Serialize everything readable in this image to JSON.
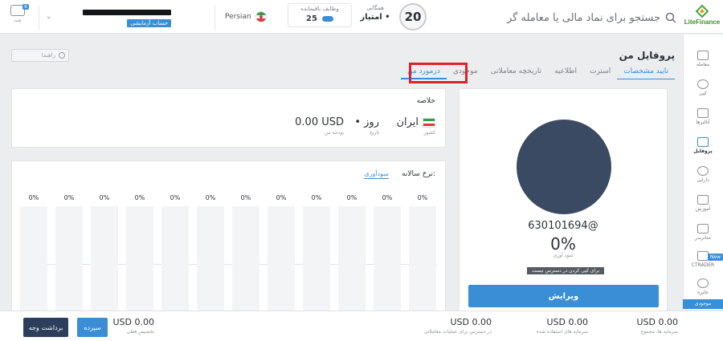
{
  "header": {
    "logo_text": "LiteFinance",
    "search_placeholder": "جستجو برای نماد مالی یا معامله گر",
    "level": "20",
    "rank_label": "همگانی",
    "rank_value": "• امتیاز",
    "tasks_label": "وظایف باقیمانده",
    "tasks_count": "25",
    "language": "Persian",
    "account_badge": "حساب آزمایشی",
    "chat_count": "6",
    "chat_label": "چت"
  },
  "sidebar": {
    "items": [
      {
        "label": "معامله",
        "icon": "chart-icon"
      },
      {
        "label": "کپی",
        "icon": "copy-icon"
      },
      {
        "label": "آنالیزها",
        "icon": "analytics-icon"
      },
      {
        "label": "پروفایل",
        "icon": "profile-icon",
        "active": true
      },
      {
        "label": "دارایی",
        "icon": "dollar-icon"
      },
      {
        "label": "آموزش",
        "icon": "education-icon"
      },
      {
        "label": "متاتریدر",
        "icon": "metatrader-icon"
      },
      {
        "label": "CTRADER",
        "icon": "ctrader-icon"
      },
      {
        "label": "جایزه",
        "icon": "award-icon"
      }
    ],
    "new_badge": "New",
    "footer": "موجودی"
  },
  "page": {
    "title": "پروفایل من",
    "help_button": "راهنما",
    "tabs": [
      {
        "label": "درمورد من",
        "state": "active"
      },
      {
        "label": "موجودی",
        "state": ""
      },
      {
        "label": "تاریخچه معاملاتی",
        "state": ""
      },
      {
        "label": "اطلاعیه",
        "state": ""
      },
      {
        "label": "استرت",
        "state": ""
      },
      {
        "label": "تایید مشخصات",
        "state": "outlined"
      }
    ]
  },
  "profile": {
    "id": "630101694@",
    "profit_pct": "0%",
    "profit_label": "سود آوری",
    "note": "برای کپی کردن در دسترس نیست",
    "edit_button": "ویرایش"
  },
  "summary": {
    "title": "خلاصه",
    "country": {
      "value": "ایران",
      "label": "کشور"
    },
    "days": {
      "value": "• روز",
      "label": "تاریخ"
    },
    "balance": {
      "value": "0.00 USD",
      "label": "بودجه من"
    }
  },
  "profitability": {
    "title": "نرخ سالانه:",
    "tab": "سودآوری",
    "values": [
      "0%",
      "0%",
      "0%",
      "0%",
      "0%",
      "0%",
      "0%",
      "0%",
      "0%",
      "0%",
      "0%",
      "0%"
    ]
  },
  "bottom": {
    "stats": [
      {
        "value": "USD 0.00",
        "label": "سرمایه ها، مجموع"
      },
      {
        "value": "USD 0.00",
        "label": "سرمایه های استفاده شده"
      },
      {
        "value": "USD 0.00",
        "label": "در دسترس برای عملیات معاملاتی"
      },
      {
        "value": "USD 0.00",
        "label": "تخصیص فعلی"
      }
    ],
    "deposit_button": "سپرده",
    "withdraw_button": "برداشت وجه"
  },
  "colors": {
    "accent": "#3a8ed6",
    "avatar": "#3a4a63",
    "highlight": "#e0202c",
    "withdraw": "#2c3e5c"
  }
}
